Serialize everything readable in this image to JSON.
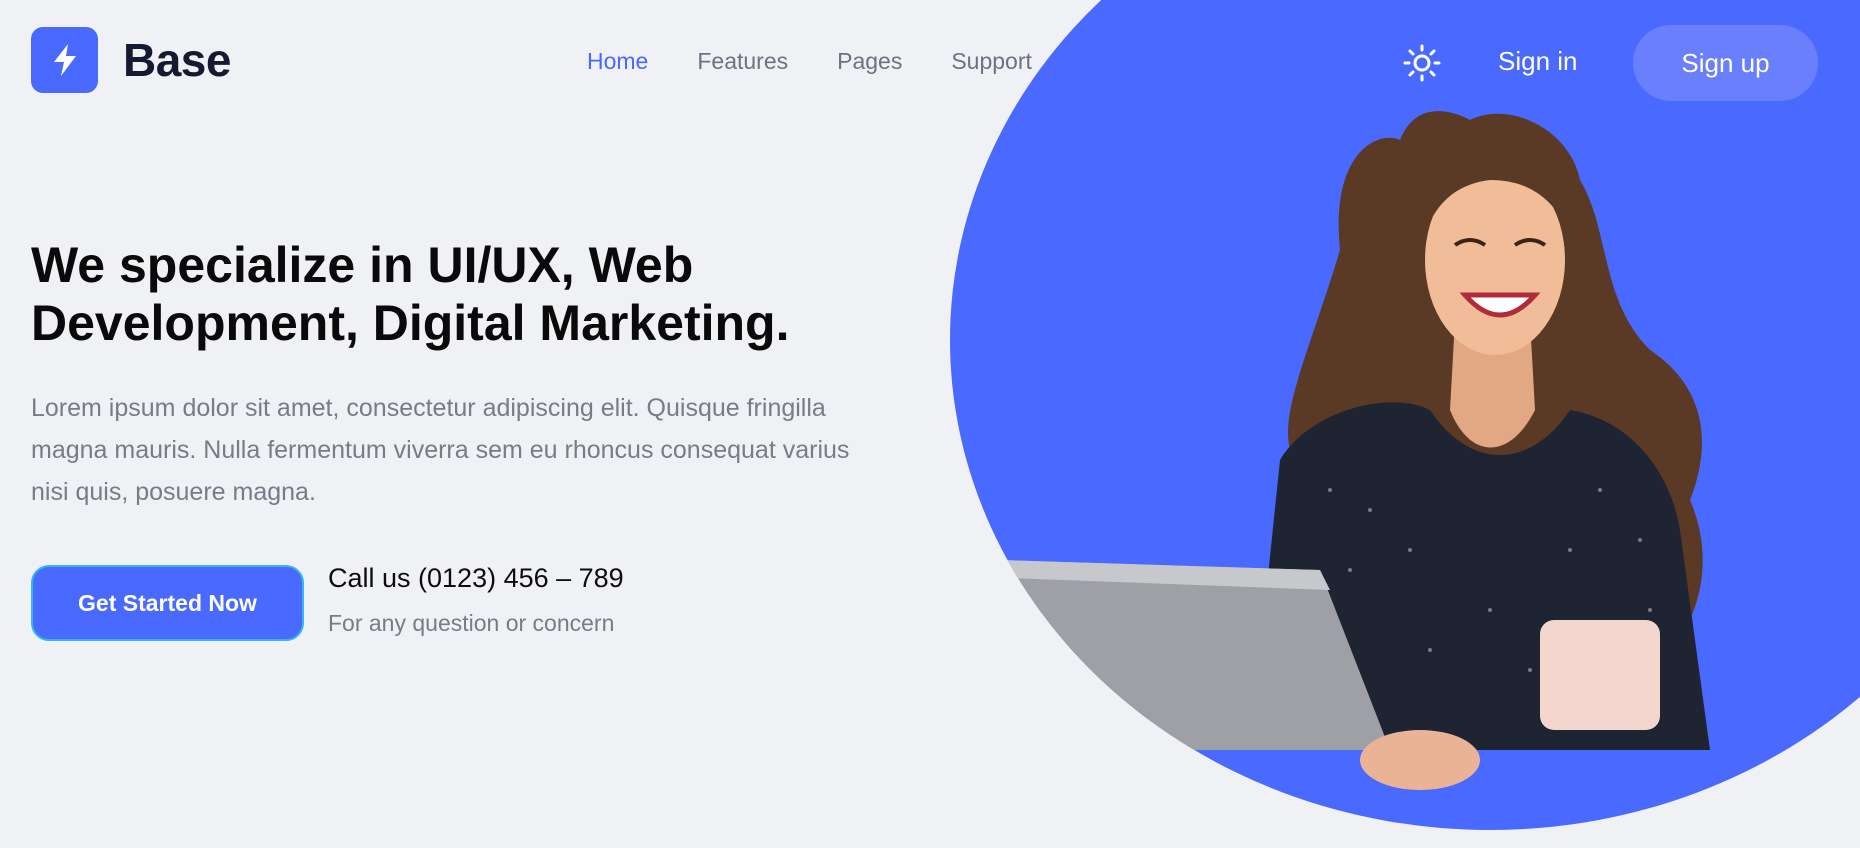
{
  "brand": {
    "name": "Base",
    "logo_icon": "lightning-icon",
    "accent": "#4a69ff"
  },
  "nav": {
    "items": [
      {
        "label": "Home",
        "active": true
      },
      {
        "label": "Features",
        "active": false
      },
      {
        "label": "Pages",
        "active": false
      },
      {
        "label": "Support",
        "active": false
      }
    ]
  },
  "header_actions": {
    "theme_icon": "sun-icon",
    "signin_label": "Sign in",
    "signup_label": "Sign up"
  },
  "hero": {
    "headline_line1": "We specialize in UI/UX, Web",
    "headline_line2": "Development, Digital Marketing.",
    "lead_line1": "Lorem ipsum dolor sit amet, consectetur adipiscing elit. Quisque fringilla",
    "lead_line2": "magna mauris. Nulla fermentum viverra sem eu rhoncus consequat varius",
    "lead_line3": "nisi quis, posuere magna.",
    "cta_label": "Get Started Now",
    "call_text": "Call us (0123) 456 – 789",
    "call_sub": "For any question or concern",
    "image_subject": "smiling-woman-with-laptop"
  }
}
